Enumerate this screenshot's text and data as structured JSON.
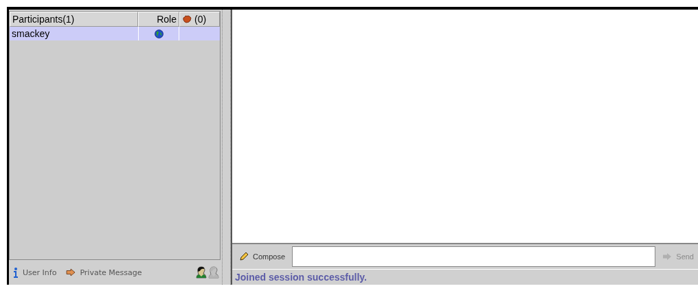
{
  "participants": {
    "columns": [
      {
        "label": "Participants(1)"
      },
      {
        "label": "Role"
      },
      {
        "label": "(0)"
      }
    ],
    "rows": [
      {
        "name": "smackey",
        "selected": true
      }
    ]
  },
  "participant_actions": [
    {
      "label": "User Info",
      "kind": "info",
      "disabled": false
    },
    {
      "label": "Private Message",
      "kind": "message",
      "disabled": false
    }
  ],
  "person_buttons": [
    {
      "disabled": false
    },
    {
      "disabled": true
    }
  ],
  "compose": {
    "label": "Compose",
    "send_label": "Send",
    "send_disabled": true
  },
  "status": "Joined session successfully."
}
